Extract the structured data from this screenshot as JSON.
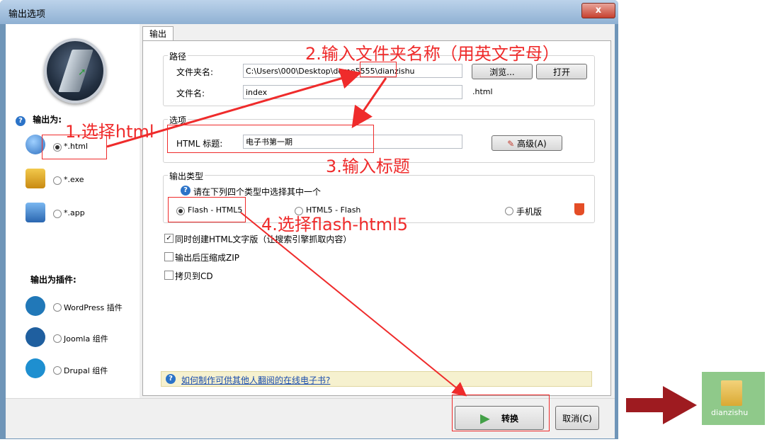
{
  "window": {
    "title": "输出选项",
    "close_label": "x"
  },
  "sidebar": {
    "output_as": "输出为:",
    "formats": [
      {
        "label": "*.html",
        "selected": true
      },
      {
        "label": "*.exe",
        "selected": false
      },
      {
        "label": "*.app",
        "selected": false
      }
    ],
    "plugins_heading": "输出为插件:",
    "plugins": [
      {
        "label": "WordPress 插件"
      },
      {
        "label": "Joomla 组件"
      },
      {
        "label": "Drupal 组件"
      }
    ]
  },
  "tab": {
    "label": "输出"
  },
  "path": {
    "group_title": "路径",
    "folder_label": "文件夹名:",
    "folder_value": "C:\\Users\\000\\Desktop\\demo5555\\dianzishu",
    "browse_button": "浏览...",
    "open_button": "打开",
    "filename_label": "文件名:",
    "filename_value": "index",
    "extension": ".html"
  },
  "options": {
    "group_title": "选项",
    "html_title_label": "HTML 标题:",
    "html_title_value": "电子书第一期",
    "advanced_button": "高级(A)"
  },
  "output_type": {
    "group_title": "输出类型",
    "hint": "请在下列四个类型中选择其中一个",
    "choices": [
      {
        "label": "Flash - HTML5",
        "selected": true
      },
      {
        "label": "HTML5 - Flash",
        "selected": false
      },
      {
        "label": "手机版",
        "selected": false
      }
    ]
  },
  "checkboxes": [
    {
      "label": "同时创建HTML文字版（让搜索引擎抓取内容）",
      "checked": true
    },
    {
      "label": "输出后压缩成ZIP",
      "checked": false
    },
    {
      "label": "拷贝到CD",
      "checked": false
    }
  ],
  "help_link": "如何制作可供其他人翻阅的在线电子书?",
  "footer": {
    "convert_button": "转换",
    "cancel_button": "取消(C)"
  },
  "annotations": {
    "step1": "1.选择html",
    "step2": "2.输入文件夹名称（用英文字母）",
    "step3": "3.输入标题",
    "step4": "4.选择flash-html5"
  },
  "result_folder": {
    "label": "dianzishu"
  },
  "colors": {
    "annotation": "#ef2b2b",
    "arrow": "#9e1b20",
    "folder_bg": "#8fc98a"
  }
}
